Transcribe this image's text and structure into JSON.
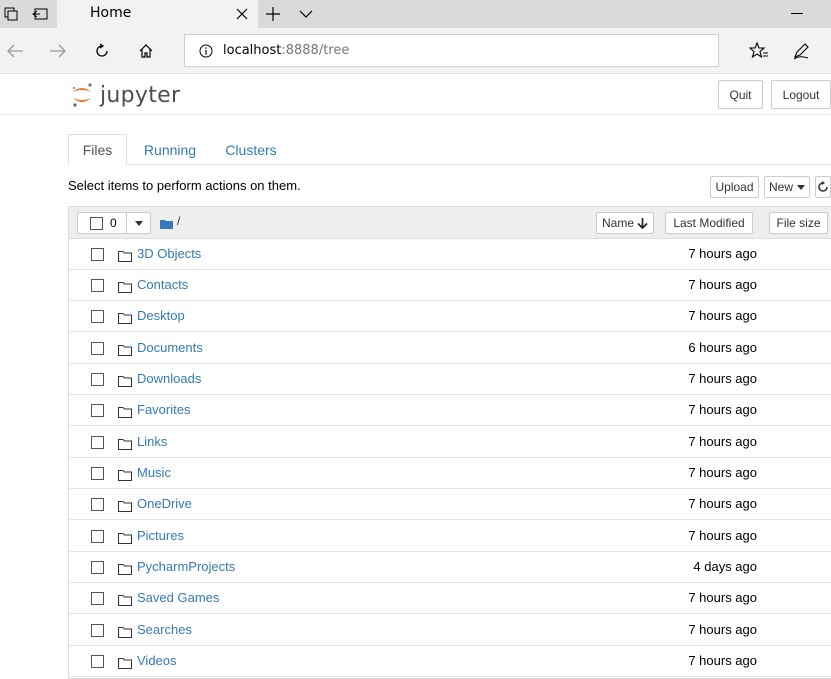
{
  "browser": {
    "tab_title": "Home",
    "url_host": "localhost",
    "url_rest": ":8888/tree"
  },
  "header": {
    "logo_text": "jupyter",
    "quit_label": "Quit",
    "logout_label": "Logout"
  },
  "tabs": [
    {
      "label": "Files"
    },
    {
      "label": "Running"
    },
    {
      "label": "Clusters"
    }
  ],
  "toolbar": {
    "instruction": "Select items to perform actions on them.",
    "upload_label": "Upload",
    "new_label": "New"
  },
  "list_header": {
    "selected_count": "0",
    "path_sep": "/",
    "name_label": "Name",
    "modified_label": "Last Modified",
    "size_label": "File size"
  },
  "files": [
    {
      "name": "3D Objects",
      "modified": "7 hours ago"
    },
    {
      "name": "Contacts",
      "modified": "7 hours ago"
    },
    {
      "name": "Desktop",
      "modified": "7 hours ago"
    },
    {
      "name": "Documents",
      "modified": "6 hours ago"
    },
    {
      "name": "Downloads",
      "modified": "7 hours ago"
    },
    {
      "name": "Favorites",
      "modified": "7 hours ago"
    },
    {
      "name": "Links",
      "modified": "7 hours ago"
    },
    {
      "name": "Music",
      "modified": "7 hours ago"
    },
    {
      "name": "OneDrive",
      "modified": "7 hours ago"
    },
    {
      "name": "Pictures",
      "modified": "7 hours ago"
    },
    {
      "name": "PycharmProjects",
      "modified": "4 days ago"
    },
    {
      "name": "Saved Games",
      "modified": "7 hours ago"
    },
    {
      "name": "Searches",
      "modified": "7 hours ago"
    },
    {
      "name": "Videos",
      "modified": "7 hours ago"
    }
  ],
  "colors": {
    "link": "#337ab7",
    "jupyter_orange": "#f37726"
  }
}
